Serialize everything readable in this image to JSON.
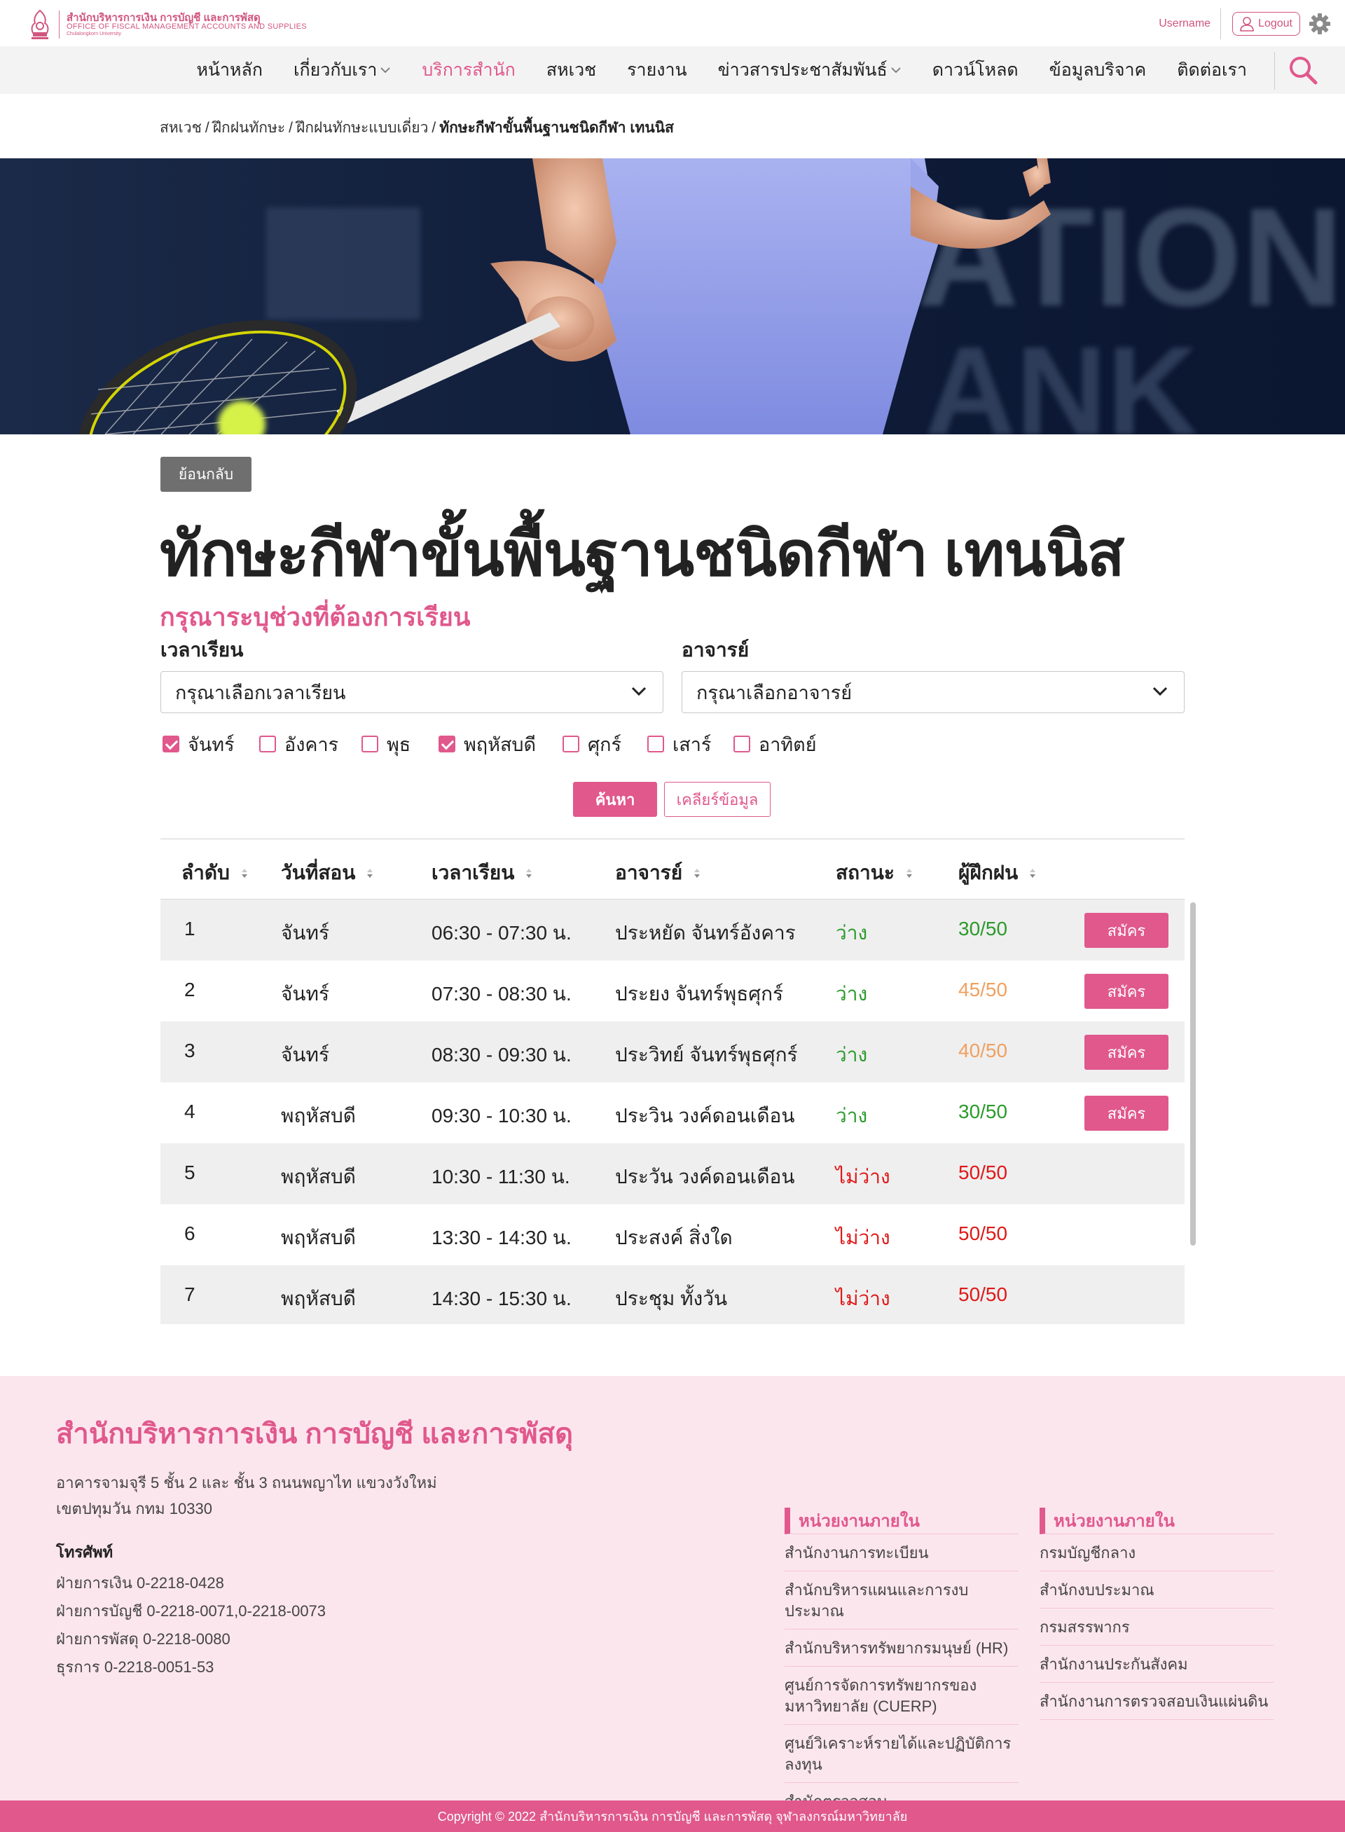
{
  "header": {
    "logo_th": "สำนักบริหารการเงิน การบัญชี และการพัสดุ",
    "logo_en": "OFFICE OF FISCAL MANAGEMENT ACCOUNTS AND SUPPLIES",
    "logo_sub": "Chulalongkorn University",
    "username": "Username",
    "logout_label": "Logout"
  },
  "nav": {
    "items": [
      {
        "label": "หน้าหลัก",
        "has_dropdown": false
      },
      {
        "label": "เกี่ยวกับเรา",
        "has_dropdown": true
      },
      {
        "label": "บริการสำนัก",
        "has_dropdown": false,
        "active": true
      },
      {
        "label": "สหเวช",
        "has_dropdown": false
      },
      {
        "label": "รายงาน",
        "has_dropdown": false
      },
      {
        "label": "ข่าวสารประชาสัมพันธ์",
        "has_dropdown": true
      },
      {
        "label": "ดาวน์โหลด",
        "has_dropdown": false
      },
      {
        "label": "ข้อมูลบริจาค",
        "has_dropdown": false
      },
      {
        "label": "ติดต่อเรา",
        "has_dropdown": false
      }
    ]
  },
  "breadcrumb": {
    "items": [
      "สหเวช",
      "ฝึกฝนทักษะ",
      "ฝึกฝนทักษะแบบเดี่ยว"
    ],
    "current": "ทักษะกีฬาขั้นพื้นฐานชนิดกีฬา เทนนิส"
  },
  "main": {
    "back_label": "ย้อนกลับ",
    "title": "ทักษะกีฬาขั้นพื้นฐานชนิดกีฬา เทนนิส",
    "subtitle": "กรุณาระบุช่วงที่ต้องการเรียน",
    "time_label": "เวลาเรียน",
    "time_placeholder": "กรุณาเลือกเวลาเรียน",
    "teacher_label": "อาจารย์",
    "teacher_placeholder": "กรุณาเลือกอาจารย์",
    "days": [
      {
        "label": "จันทร์",
        "checked": true
      },
      {
        "label": "อังคาร",
        "checked": false
      },
      {
        "label": "พุธ",
        "checked": false
      },
      {
        "label": "พฤหัสบดี",
        "checked": true
      },
      {
        "label": "ศุกร์",
        "checked": false
      },
      {
        "label": "เสาร์",
        "checked": false
      },
      {
        "label": "อาทิตย์",
        "checked": false
      }
    ],
    "search_label": "ค้นหา",
    "clear_label": "เคลียร์ข้อมูล"
  },
  "table": {
    "headers": [
      "ลำดับ",
      "วันที่สอน",
      "เวลาเรียน",
      "อาจารย์",
      "สถานะ",
      "ผู้ฝึกฝน"
    ],
    "apply_label": "สมัคร",
    "rows": [
      {
        "no": "1",
        "day": "จันทร์",
        "time": "06:30 - 07:30 น.",
        "teacher": "ประหยัด จันทร์อังคาร",
        "status": "ว่าง",
        "available": true,
        "count": "30/50",
        "count_level": "green"
      },
      {
        "no": "2",
        "day": "จันทร์",
        "time": "07:30 - 08:30 น.",
        "teacher": "ประยง จันทร์พุธศุกร์",
        "status": "ว่าง",
        "available": true,
        "count": "45/50",
        "count_level": "orange"
      },
      {
        "no": "3",
        "day": "จันทร์",
        "time": "08:30 - 09:30 น.",
        "teacher": "ประวิทย์ จันทร์พุธศุกร์",
        "status": "ว่าง",
        "available": true,
        "count": "40/50",
        "count_level": "orange"
      },
      {
        "no": "4",
        "day": "พฤหัสบดี",
        "time": "09:30 - 10:30 น.",
        "teacher": "ประวิน วงค์ดอนเดือน",
        "status": "ว่าง",
        "available": true,
        "count": "30/50",
        "count_level": "green"
      },
      {
        "no": "5",
        "day": "พฤหัสบดี",
        "time": "10:30 - 11:30 น.",
        "teacher": "ประวัน วงค์ดอนเดือน",
        "status": "ไม่ว่าง",
        "available": false,
        "count": "50/50",
        "count_level": "red"
      },
      {
        "no": "6",
        "day": "พฤหัสบดี",
        "time": "13:30 - 14:30 น.",
        "teacher": "ประสงค์ สิ่งใด",
        "status": "ไม่ว่าง",
        "available": false,
        "count": "50/50",
        "count_level": "red"
      },
      {
        "no": "7",
        "day": "พฤหัสบดี",
        "time": "14:30 - 15:30 น.",
        "teacher": "ประชุม ทั้งวัน",
        "status": "ไม่ว่าง",
        "available": false,
        "count": "50/50",
        "count_level": "red"
      }
    ]
  },
  "footer": {
    "title": "สำนักบริหารการเงิน การบัญชี และการพัสดุ",
    "address_line1": "อาคารจามจุรี 5 ชั้น 2 และ ชั้น 3 ถนนพญาไท แขวงวังใหม่",
    "address_line2": "เขตปทุมวัน กทม 10330",
    "phone_heading": "โทรศัพท์",
    "phones": [
      "ฝ่ายการเงิน 0-2218-0428",
      "ฝ่ายการบัญชี 0-2218-0071,0-2218-0073",
      "ฝ่ายการพัสดุ 0-2218-0080",
      "ธุรการ 0-2218-0051-53"
    ],
    "col1_title": "หน่วยงานภายใน",
    "col1_items": [
      "สำนักงานการทะเบียน",
      "สำนักบริหารแผนและการงบประมาณ",
      "สำนักบริหารทรัพยากรมนุษย์ (HR)",
      "ศูนย์การจัดการทรัพยากรของมหาวิทยาลัย (CUERP)",
      "ศูนย์วิเคราะห์รายได้และปฏิบัติการลงทุน",
      "สำนักตรวจสอบ"
    ],
    "col2_title": "หน่วยงานภายใน",
    "col2_items": [
      "กรมบัญชีกลาง",
      "สำนักงบประมาณ",
      "กรมสรรพากร",
      "สำนักงานประกันสังคม",
      "สำนักงานการตรวจสอบเงินแผ่นดิน"
    ],
    "copyright": "Copyright © 2022 สำนักบริหารการเงิน การบัญชี และการพัสดุ จุฬาลงกรณ์มหาวิทยาลัย"
  },
  "colors": {
    "accent": "#e0588c",
    "available": "#2a9a2a",
    "unavailable": "#e01818",
    "near_full": "#f0a060",
    "footer_bg": "#fce6ee"
  },
  "icons": {
    "logo": "university-seal-icon",
    "user": "user-icon",
    "settings": "gear-icon",
    "search": "search-icon",
    "dropdown": "chevron-down-icon",
    "sort": "sort-icon"
  }
}
